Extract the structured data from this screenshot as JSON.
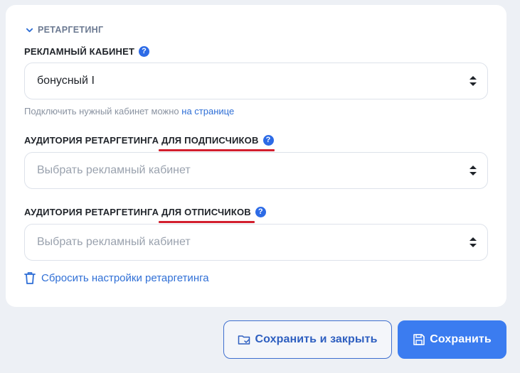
{
  "section": {
    "title": "РЕТАРГЕТИНГ"
  },
  "ad_cabinet": {
    "label": "РЕКЛАМНЫЙ КАБИНЕТ",
    "value": "бонусный I",
    "hint_prefix": "Подключить нужный кабинет можно",
    "hint_link": "на странице"
  },
  "subscribers_audience": {
    "label_start": "АУДИТОРИЯ РЕТАРГЕТИНГА",
    "label_end": "ДЛЯ ПОДПИСЧИКОВ",
    "placeholder": "Выбрать рекламный кабинет"
  },
  "unsubscribers_audience": {
    "label_start": "АУДИТОРИЯ РЕТАРГЕТИНГА",
    "label_end": "ДЛЯ ОТПИСЧИКОВ",
    "placeholder": "Выбрать рекламный кабинет"
  },
  "reset": {
    "label": "Сбросить настройки ретаргетинга"
  },
  "footer": {
    "save_close_label": "Сохранить и закрыть",
    "save_label": "Сохранить"
  },
  "colors": {
    "accent": "#3b7cf0",
    "link": "#2f6fd6",
    "annotation_underline": "#d21f2e",
    "background": "#edf0f5"
  }
}
